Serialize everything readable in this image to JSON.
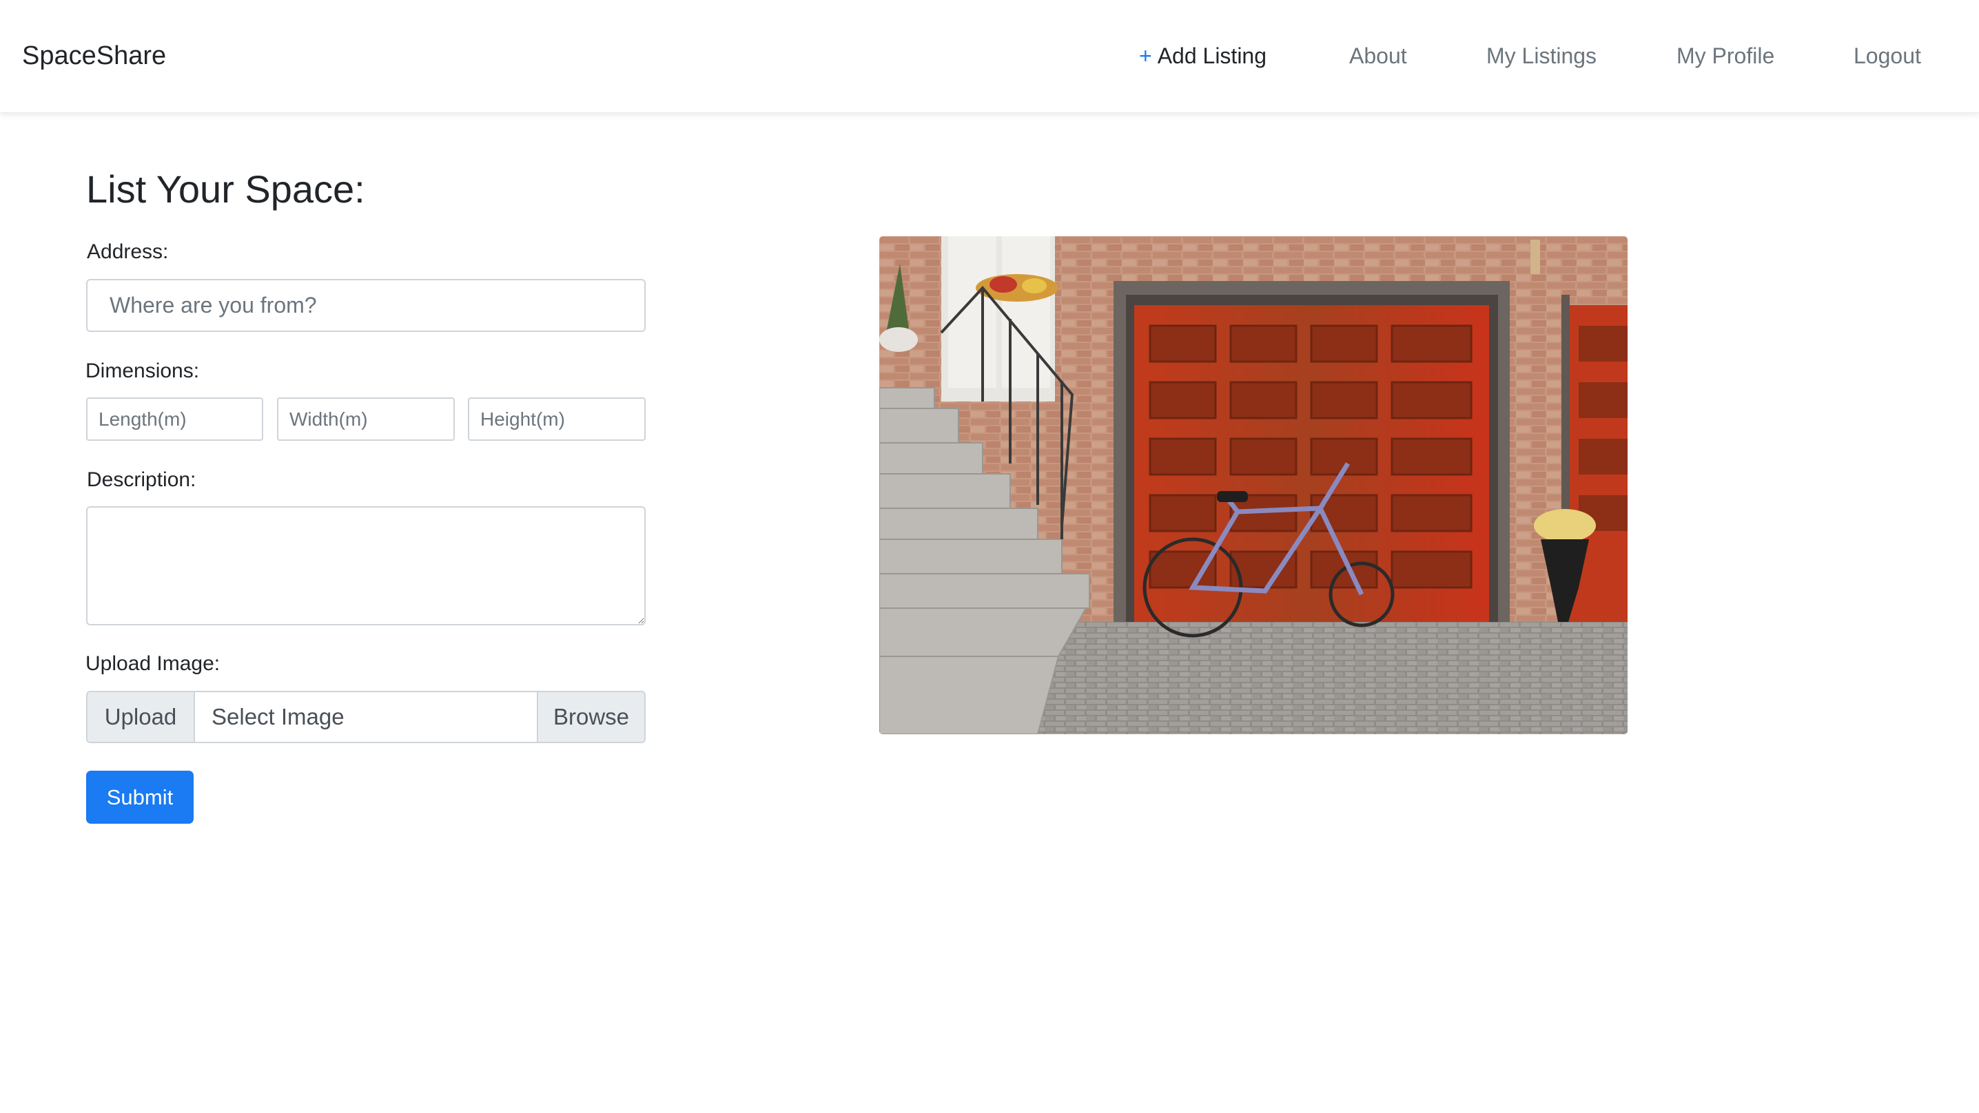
{
  "brand": "SpaceShare",
  "nav": {
    "add_listing": "Add Listing",
    "about": "About",
    "my_listings": "My Listings",
    "my_profile": "My Profile",
    "logout": "Logout"
  },
  "form": {
    "title": "List Your Space:",
    "address_label": "Address:",
    "address_placeholder": "Where are you from?",
    "dimensions_label": "Dimensions:",
    "length_placeholder": "Length(m)",
    "width_placeholder": "Width(m)",
    "height_placeholder": "Height(m)",
    "description_label": "Description:",
    "upload_label": "Upload Image:",
    "upload_prefix": "Upload",
    "upload_file_text": "Select Image",
    "browse": "Browse",
    "submit": "Submit"
  },
  "colors": {
    "primary": "#1a7bf2",
    "muted_text": "#6c757d",
    "border": "#ced4da"
  },
  "icons": {
    "add_listing": "plus-icon"
  }
}
